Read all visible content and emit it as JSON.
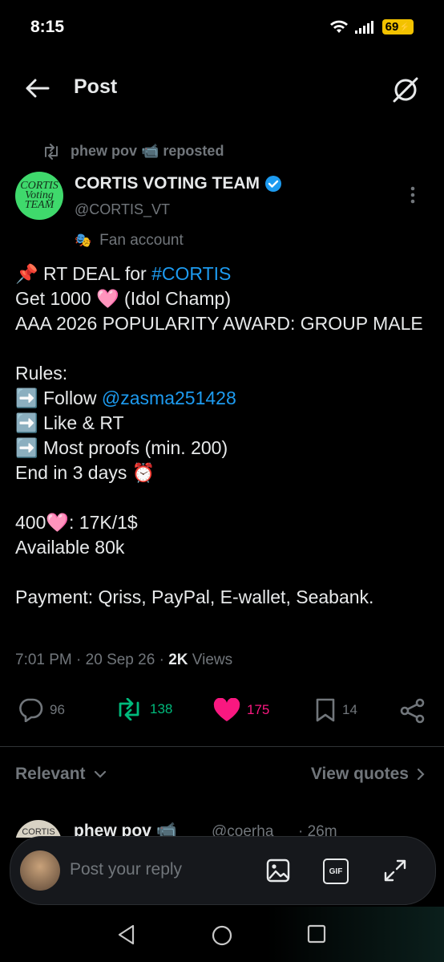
{
  "status_bar": {
    "time": "8:15",
    "battery": "69"
  },
  "header": {
    "title": "Post"
  },
  "repost": {
    "text": "phew pov 📹 reposted"
  },
  "author": {
    "avatar_text": "CORTIS Voting TEAM",
    "name": "CORTIS VOTING TEAM",
    "handle": "@CORTIS_VT",
    "label": "Fan account"
  },
  "post": {
    "line1_prefix": "📌 RT DEAL for ",
    "line1_tag": "#CORTIS",
    "line2": "Get 1000 🩷 (Idol Champ)",
    "line3": "AAA 2026 POPULARITY AWARD: GROUP MALE",
    "line4": "Rules:",
    "line5_prefix": "➡️ Follow ",
    "line5_link": "@zasma251428",
    "line6": "➡️ Like & RT",
    "line7": "➡️ Most proofs (min. 200)",
    "line8": "End in 3 days ⏰",
    "line9": "400🩷: 17K/1$",
    "line10": "Available 80k",
    "line11": "Payment: Qriss, PayPal, E-wallet, Seabank."
  },
  "meta": {
    "time": "7:01 PM",
    "date": "20 Sep 26",
    "views_count": "2K",
    "views_label": "Views"
  },
  "actions": {
    "replies": "96",
    "reposts": "138",
    "likes": "175",
    "bookmarks": "14"
  },
  "colors": {
    "repost": "#00ba7c",
    "like": "#f91880",
    "link": "#1d9bf0"
  },
  "replies_section": {
    "sort": "Relevant",
    "view_quotes": "View quotes"
  },
  "reply_preview": {
    "avatar_text": "CORTIS",
    "name": "phew pov 📹",
    "handle": "@coerha",
    "time": "· 26m"
  },
  "composer": {
    "placeholder": "Post your reply",
    "gif": "GIF"
  }
}
